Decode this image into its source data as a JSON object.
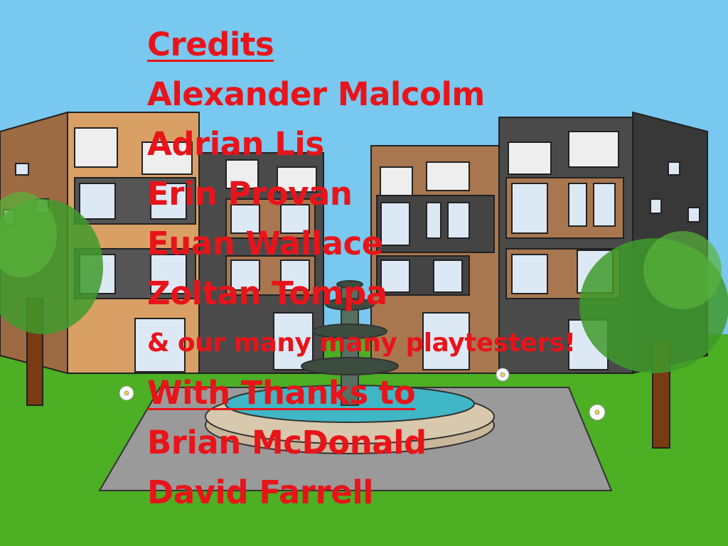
{
  "palette": {
    "sky": "#79c8ef",
    "grass": "#4caf24",
    "text": "#e8141a",
    "building_orange": "#d9a066",
    "building_dark": "#444444",
    "building_brown": "#a9774f",
    "plaza": "#9a9a9a",
    "water": "#3fb7c6"
  },
  "credits": {
    "title": "Credits",
    "names": [
      "Alexander Malcolm",
      "Adrian Lis",
      "Erin Provan",
      "Euan Wallace",
      "Zoltan Tompa"
    ],
    "extra": "& our many many playtesters!",
    "thanks_title": "With Thanks to",
    "thanks": [
      "Brian McDonald",
      "David Farrell"
    ]
  }
}
